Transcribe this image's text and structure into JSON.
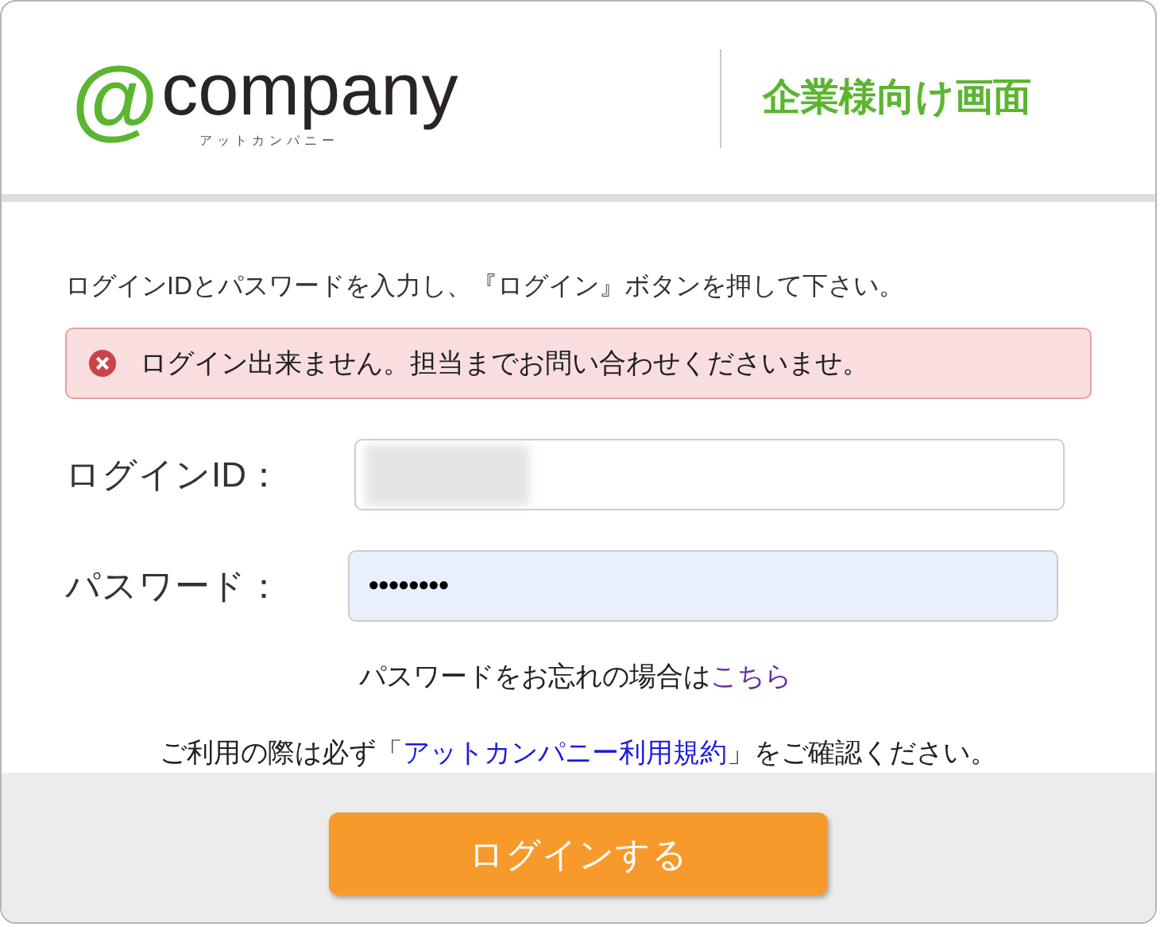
{
  "header": {
    "logo": {
      "mark": "@",
      "name": "company",
      "reading": "アットカンパニー"
    },
    "title": "企業様向け画面"
  },
  "instruction": "ログインIDとパスワードを入力し、『ログイン』ボタンを押して下さい。",
  "error": {
    "message": "ログイン出来ません。担当までお問い合わせくださいませ。"
  },
  "fields": [
    {
      "kind": "text",
      "label": "ログインID：",
      "value_hidden": true
    },
    {
      "kind": "password",
      "label": "パスワード：",
      "value": "••••••••",
      "autofilled": true
    }
  ],
  "forgot": {
    "text": "パスワードをお忘れの場合は",
    "link": "こちら"
  },
  "terms": {
    "before": "ご利用の際は必ず「",
    "link": "アットカンパニー利用規約",
    "after": "」をご確認ください。"
  },
  "login_button": "ログインする"
}
